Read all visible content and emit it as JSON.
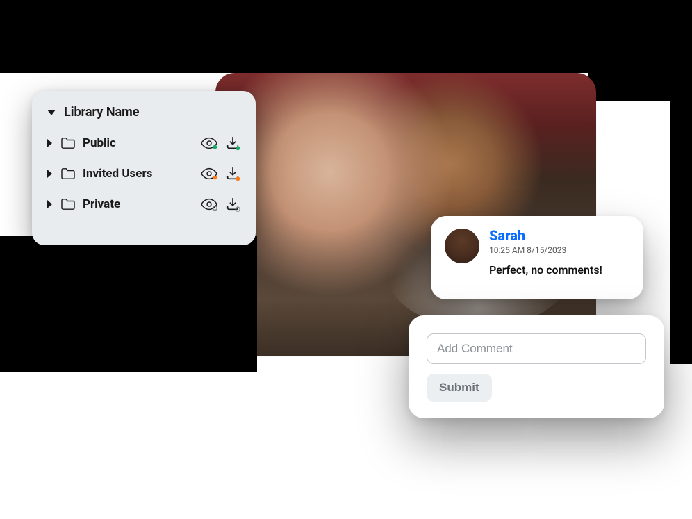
{
  "library": {
    "title": "Library Name",
    "items": [
      {
        "label": "Public",
        "status_color": "#18a966"
      },
      {
        "label": "Invited Users",
        "status_color": "#ff7a1a"
      },
      {
        "label": "Private",
        "status_color": "#7e8690"
      }
    ]
  },
  "comment": {
    "author": "Sarah",
    "timestamp": "10:25 AM 8/15/2023",
    "text": "Perfect, no comments!"
  },
  "add_comment": {
    "placeholder": "Add Comment",
    "submit_label": "Submit"
  },
  "icons": {
    "folder": "folder-icon",
    "eye": "eye-icon",
    "download": "download-icon",
    "caret_right": "chevron-right-icon",
    "caret_down": "chevron-down-icon"
  },
  "colors": {
    "panel_bg": "#e8ecef",
    "link_blue": "#0a6cff"
  }
}
